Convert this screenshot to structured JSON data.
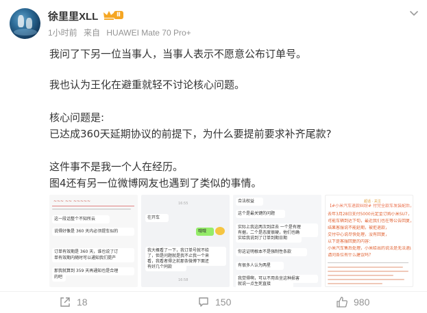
{
  "user": {
    "name": "徐里里XLL",
    "vip_level": "Ⅱ"
  },
  "meta": {
    "time": "1小时前",
    "source_prefix": "来自",
    "device": "HUAWEI Mate 70 Pro+"
  },
  "content": [
    "我问了下另一位当事人，当事人表示不愿意公布订单号。",
    "我也认为王化在避重就轻不讨论核心问题。",
    "核心问题是:",
    "已达成360天延期协议的前提下，为什么要提前要求补齐尾款?",
    "这件事不是我一个人在经历。",
    "图4还有另一位微博网友也遇到了类似的事情。"
  ],
  "images": {
    "img1": {
      "handwriting": "~~~ ~~ ~~~~~",
      "bubbles": [
        "这一段话整个不知所云",
        "说得好像是 360 天内必须提车似的",
        "订单有效期是 360 天，谁也说了订",
        "单有效期内随时可以通知我们提产",
        "那我就算到 359 天再通知也是合理",
        "的吧"
      ]
    },
    "img2": {
      "time1": "16:55",
      "bubbles": [
        "在开车",
        "哦哦",
        "我大概看了一下，我订单号就不给",
        "了，但是问题就是我不止我一个来",
        "看，我看者得之前那条微博下面还",
        "有好几个同款"
      ],
      "time2": "16:58"
    },
    "img3": {
      "bubbles": [
        "合法权益",
        "这个是最关键的问题",
        "实际上我这两次到店去 一个是有理",
        "有据，二个是态度很硬，他们也确",
        "实给我说到了订单到期日期",
        "你这证明根本不是强制性条款",
        "有很多人认为两星",
        "我觉得啊，可以不用去坐这种损害",
        "就说一点生死直接"
      ]
    },
    "img4": {
      "tag": "超话 · 关注",
      "title": "【#小米汽车退款纠纷# 付完全款车发装配后，或无我的公司】",
      "paragraphs": [
        "去年3月28日支付5000元定金订购小米SU7，因个人原因推迟提车至今年1月，APP提示订单至36-37周，锁单日至5月22号，小米展厅经理答应跟进，",
        "可能车辆到达下旬，最近我们也在等公告回复，",
        "结果客服说不能延期，被拒退款，",
        "交付中心说尽快处理，没有回复，",
        "以下是客服回复的内容：",
        "小米汽车售后处理，小米给出的说法是无法退回定金，",
        "请问各位有什么建议吗？"
      ]
    }
  },
  "actions": {
    "repost_count": "18",
    "comment_count": "150",
    "like_count": "980"
  },
  "colors": {
    "accent_orange": "#f5a623",
    "meta_gray": "#939393",
    "text": "#333333",
    "chat_green": "#95ec69"
  }
}
